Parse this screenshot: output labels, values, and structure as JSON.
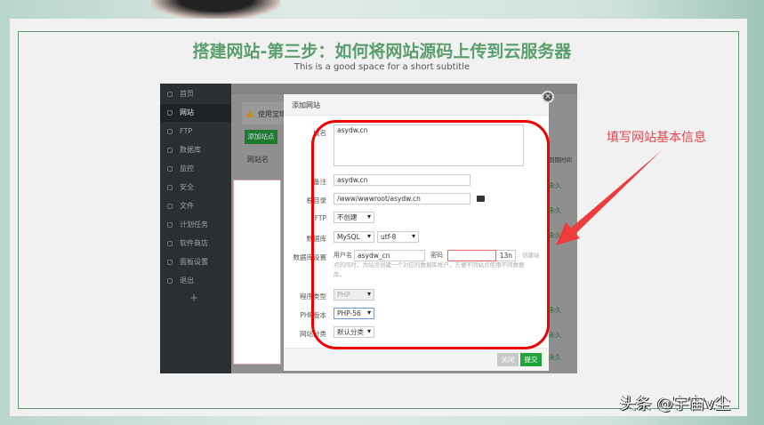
{
  "slide": {
    "title": "搭建网站-第三步：如何将网站源码上传到云服务器",
    "subtitle": "This is a good space for a short subtitle"
  },
  "sidebar": {
    "items": [
      {
        "label": "首页"
      },
      {
        "label": "网站",
        "active": true
      },
      {
        "label": "FTP"
      },
      {
        "label": "数据库"
      },
      {
        "label": "监控"
      },
      {
        "label": "安全"
      },
      {
        "label": "文件"
      },
      {
        "label": "计划任务"
      },
      {
        "label": "软件商店"
      },
      {
        "label": "面板设置"
      },
      {
        "label": "退出"
      }
    ],
    "add": "+"
  },
  "page": {
    "warning": "使用宝塔",
    "add_site": "添加站点",
    "col_name": "网站名",
    "col_expire": "到期时间",
    "row_value": "永久"
  },
  "modal": {
    "title": "添加网站",
    "close": "×",
    "domain_label": "域名",
    "domain_value": "asydw.cn",
    "remark_label": "备注",
    "remark_value": "asydw.cn",
    "root_label": "根目录",
    "root_value": "/www/wwwroot/asydw.cn",
    "ftp_label": "FTP",
    "ftp_value": "不创建",
    "db_label": "数据库",
    "db_value": "MySQL",
    "db_charset": "utf-8",
    "dbset_label": "数据库设置",
    "user_label": "用户名",
    "user_value": "asydw_cn",
    "pass_label": "密码",
    "pass_value": "13n",
    "db_help_1": "创建站",
    "db_help_2": "点的同时，为站点创建一个对应的数据库帐户，方便不同站点使用不同数据",
    "db_help_3": "库。",
    "type_label": "程序类型",
    "type_value": "PHP",
    "php_label": "PHP版本",
    "php_value": "PHP-56",
    "cat_label": "网站分类",
    "cat_value": "默认分类",
    "cancel": "关闭",
    "submit": "提交"
  },
  "annotation": "填写网站基本信息",
  "watermark": "头条 @宇宙v尘",
  "colors": {
    "accent": "#5a9e6e",
    "annotation": "#e8454d",
    "submit": "#20a53a"
  }
}
